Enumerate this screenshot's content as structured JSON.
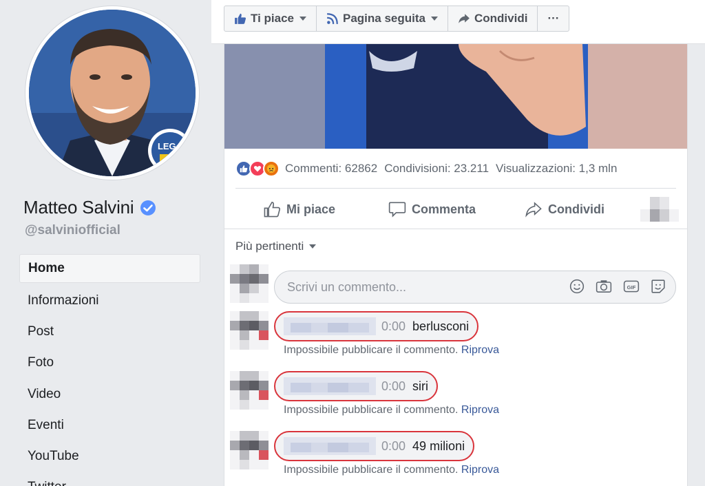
{
  "profile": {
    "name": "Matteo Salvini",
    "handle": "@salviniofficial",
    "badge_text": "LEGA"
  },
  "nav": {
    "items": [
      {
        "label": "Home",
        "active": true
      },
      {
        "label": "Informazioni"
      },
      {
        "label": "Post"
      },
      {
        "label": "Foto"
      },
      {
        "label": "Video"
      },
      {
        "label": "Eventi"
      },
      {
        "label": "YouTube"
      },
      {
        "label": "Twitter"
      }
    ]
  },
  "actionbar": {
    "like_label": "Ti piace",
    "follow_label": "Pagina seguita",
    "share_label": "Condividi",
    "more_label": "···"
  },
  "post": {
    "stats": {
      "comments": "Commenti: 62862",
      "shares": "Condivisioni: 23.211",
      "views": "Visualizzazioni: 1,3 mln"
    },
    "actions": {
      "like": "Mi piace",
      "comment": "Commenta",
      "share": "Condividi"
    },
    "sort_label": "Più pertinenti",
    "comment_placeholder": "Scrivi un commento...",
    "comments": [
      {
        "time": "0:00",
        "text": "berlusconi",
        "error": "Impossibile pubblicare il commento.",
        "retry": "Riprova"
      },
      {
        "time": "0:00",
        "text": "siri",
        "error": "Impossibile pubblicare il commento.",
        "retry": "Riprova"
      },
      {
        "time": "0:00",
        "text": "49 milioni",
        "error": "Impossibile pubblicare il commento.",
        "retry": "Riprova"
      }
    ]
  },
  "colors": {
    "fb_blue": "#4267b2",
    "link": "#385898",
    "highlight_red": "#d9343b",
    "verified_blue": "#5890ff"
  }
}
